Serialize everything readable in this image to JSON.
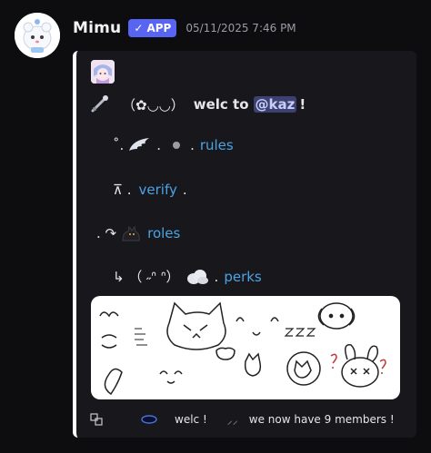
{
  "message": {
    "username": "Mimu",
    "badge_label": "APP",
    "badge_check": "✓",
    "timestamp": "05/11/2025 7:46 PM"
  },
  "embed": {
    "accent_color": "#ffffff",
    "line1": {
      "prefix": "（✿◡◡）",
      "text": "welc to",
      "mention": "@kaz",
      "suffix": "!"
    },
    "line2": {
      "prefix": "˚.",
      "mid": ".",
      "mid2": ".",
      "link": "rules"
    },
    "line3": {
      "prefix": "⊼ .",
      "link": "verify",
      "suffix": "."
    },
    "line4": {
      "prefix": ". ↷",
      "link": "roles"
    },
    "line5": {
      "prefix": "↳ （ ˶ᐢ ᐢ）",
      "mid": ".",
      "link": "perks"
    },
    "footer": {
      "text1": "welc !",
      "sep": "⸝⸝",
      "text2": "we now have 9 members !"
    }
  },
  "colors": {
    "background": "#0d0d10",
    "embed_bg": "#18181c",
    "link": "#4ba3e3",
    "badge": "#5865f2",
    "mention_bg": "#3c4270"
  },
  "icons": [
    "mimu-avatar",
    "kaz-thumbnail",
    "wand-icon",
    "wing-icon",
    "dot-icon",
    "black-cat-icon",
    "cloud-icon",
    "copy-icon",
    "portal-icon"
  ]
}
